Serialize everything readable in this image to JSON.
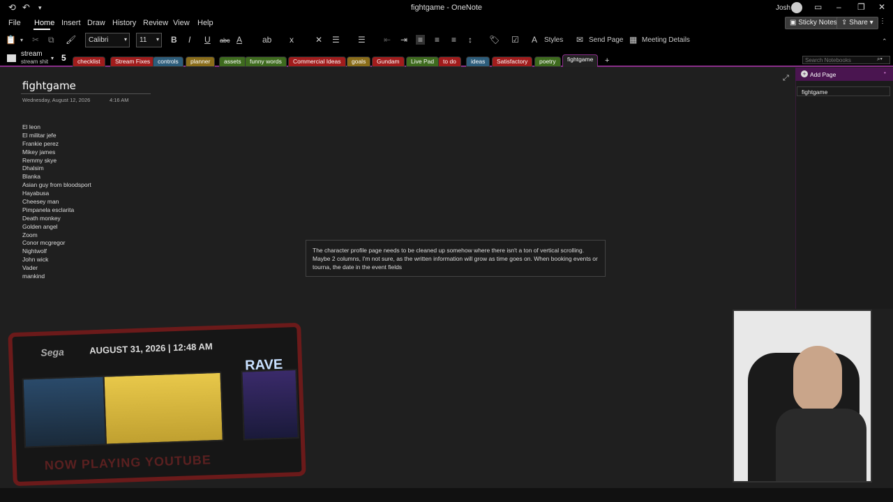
{
  "window": {
    "title": "fightgame  -  OneNote",
    "user": "Josh"
  },
  "menu": [
    "File",
    "Home",
    "Insert",
    "Draw",
    "History",
    "Review",
    "View",
    "Help"
  ],
  "actions": {
    "sticky_notes": "Sticky Notes",
    "share": "Share"
  },
  "ribbon": {
    "font": "Calibri",
    "size": "11",
    "bold": "B",
    "italic": "I",
    "underline": "U",
    "strike": "abc",
    "styles": "Styles",
    "send_page": "Send Page",
    "meeting_details": "Meeting Details"
  },
  "notebook": {
    "name": "stream",
    "section_group": "stream shit",
    "count": "5"
  },
  "tabs": [
    {
      "label": "checklist",
      "color": "#a11c1c"
    },
    {
      "label": "Stream Fixes",
      "color": "#a11c1c"
    },
    {
      "label": "controls",
      "color": "#2d5d7b"
    },
    {
      "label": "planner",
      "color": "#8a6d1a"
    },
    {
      "label": "assets",
      "color": "#3e6b1e"
    },
    {
      "label": "funny words",
      "color": "#3e6b1e"
    },
    {
      "label": "Commercial Ideas",
      "color": "#a11c1c"
    },
    {
      "label": "goals",
      "color": "#8a6d1a"
    },
    {
      "label": "Gundam",
      "color": "#a11c1c"
    },
    {
      "label": "Live Pad",
      "color": "#3e6b1e"
    },
    {
      "label": "to do",
      "color": "#a11c1c"
    },
    {
      "label": "ideas",
      "color": "#2d5d7b"
    },
    {
      "label": "Satisfactory",
      "color": "#a11c1c"
    },
    {
      "label": "poetry",
      "color": "#3e6b1e"
    },
    {
      "label": "fightgame",
      "color": "#222222",
      "active": true
    }
  ],
  "search": {
    "placeholder": "Search Notebooks"
  },
  "page": {
    "title": "fightgame",
    "date": "Wednesday, August 12, 2026",
    "time": "4:16 AM",
    "characters": [
      "El leon",
      "El militar jefe",
      "Frankie perez",
      "Mikey james",
      "Remmy skye",
      "Dhalsim",
      "Blanka",
      "Asian guy from bloodsport",
      "Hayabusa",
      "Cheesey man",
      "Pimpanela esclarita",
      "Death monkey",
      "Golden angel",
      "Zoom",
      "Conor mcgregor",
      "Nightwolf",
      "John wick",
      "Vader",
      "mankind"
    ],
    "note": "The character profile page needs to be cleaned up somehow where there isn't a ton of vertical scrolling. Maybe 2 columns, I'm not sure, as the written information will grow as time goes on. When booking events or tourna, the date in the event fields"
  },
  "sidebar": {
    "add_page": "Add Page",
    "pages": [
      "fightgame"
    ]
  },
  "overlay": {
    "date": "AUGUST 31, 2026  |  12:48 AM",
    "logo": "Sega",
    "rave": "RAVE",
    "now_playing": "NOW PLAYING YOUTUBE"
  }
}
